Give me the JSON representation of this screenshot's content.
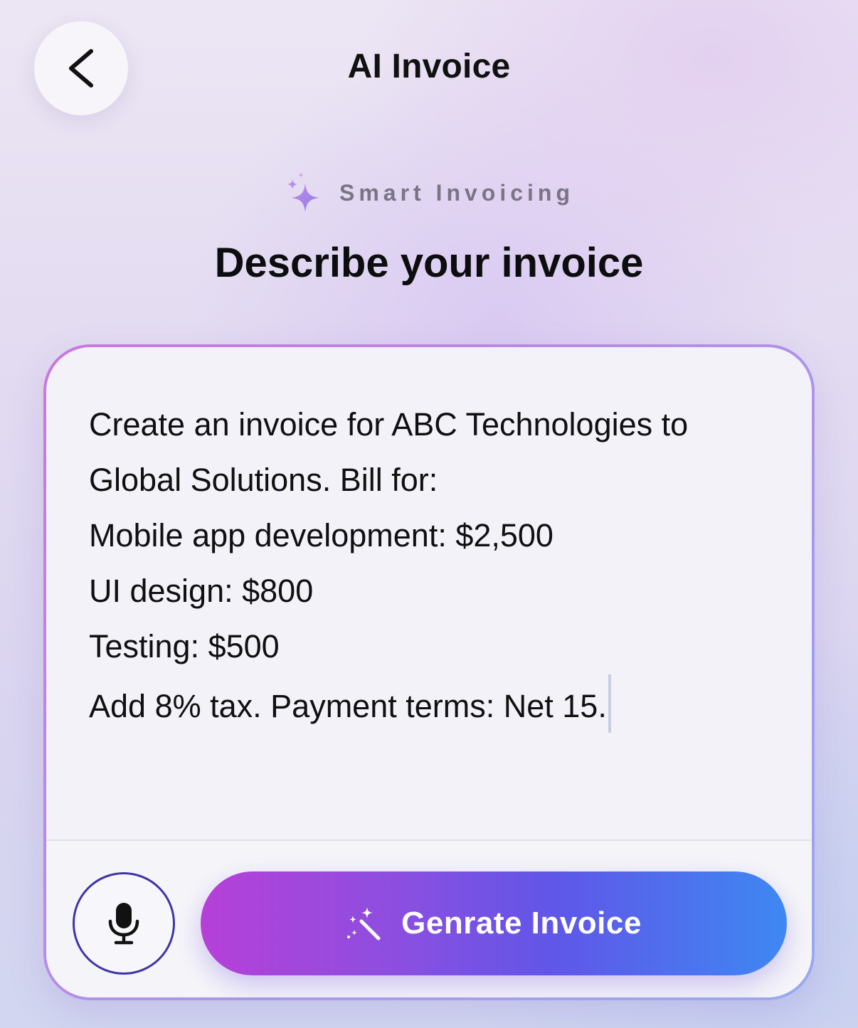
{
  "header": {
    "title": "AI Invoice",
    "back_icon": "chevron-left-icon"
  },
  "tagline": {
    "icon": "sparkles-icon",
    "text": "Smart Invoicing"
  },
  "headline": "Describe your invoice",
  "prompt": {
    "lines": [
      "Create an invoice for ABC Technologies to",
      "Global Solutions. Bill for:",
      "Mobile app development: $2,500",
      "UI design: $800",
      "Testing: $500",
      "Add 8% tax. Payment terms: Net 15."
    ]
  },
  "actions": {
    "mic_icon": "microphone-icon",
    "generate_icon": "magic-wand-icon",
    "generate_label": "Genrate Invoice"
  },
  "colors": {
    "accent_start": "#b640d8",
    "accent_end": "#3e88f2",
    "mic_border": "#3f34a8",
    "tagline_sparkle": "#a77be6"
  }
}
